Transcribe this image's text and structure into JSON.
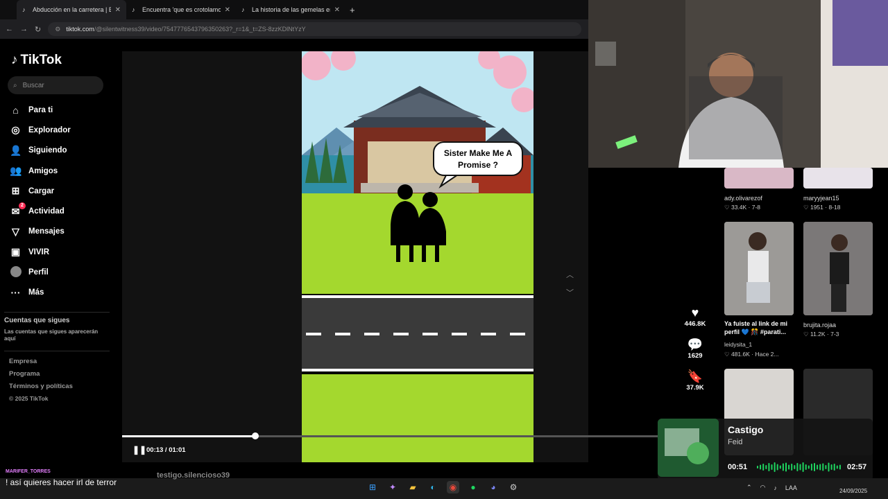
{
  "browser": {
    "tabs": [
      {
        "title": "Abducción en la carretera | Ep",
        "active": true
      },
      {
        "title": "Encuentra 'que es crotolamo' e",
        "active": false
      },
      {
        "title": "La historia de las gemelas en Je",
        "active": false
      }
    ],
    "new_tab": "+",
    "url_domain": "tiktok.com",
    "url_path": "/@silentwitness39/video/7547776543796350263?_r=1&_t=ZS-8zzKDlNtYzY"
  },
  "sidebar": {
    "logo": "TikTok",
    "search_placeholder": "Buscar",
    "nav": [
      {
        "label": "Para ti",
        "icon": "home-icon",
        "glyph": "⌂"
      },
      {
        "label": "Explorador",
        "icon": "compass-icon",
        "glyph": "◎"
      },
      {
        "label": "Siguiendo",
        "icon": "following-icon",
        "glyph": "👤"
      },
      {
        "label": "Amigos",
        "icon": "friends-icon",
        "glyph": "👥"
      },
      {
        "label": "Cargar",
        "icon": "upload-icon",
        "glyph": "⊞"
      },
      {
        "label": "Actividad",
        "icon": "activity-icon",
        "glyph": "✉",
        "badge": "2"
      },
      {
        "label": "Mensajes",
        "icon": "messages-icon",
        "glyph": "▽"
      },
      {
        "label": "VIVIR",
        "icon": "live-icon",
        "glyph": "▣"
      },
      {
        "label": "Perfil",
        "icon": "profile-avatar",
        "glyph": ""
      },
      {
        "label": "Más",
        "icon": "more-icon",
        "glyph": "···"
      }
    ],
    "following_heading": "Cuentas que sigues",
    "following_text": "Las cuentas que sigues aparecerán aquí",
    "footer": [
      "Empresa",
      "Programa",
      "Términos y políticas"
    ],
    "copyright": "© 2025 TikTok"
  },
  "video": {
    "speech": "Sister Make Me A Promise ?",
    "likes": "446.8K",
    "comments": "1629",
    "saves": "37.9K",
    "current_time": "00:13",
    "duration": "01:01",
    "time_display": "00:13 / 01:01",
    "progress": 0.246
  },
  "recommendations": [
    {
      "user": "ady.olivarezof",
      "meta": "♡ 33.4K · 7-8"
    },
    {
      "user": "maryyjean15",
      "meta": "♡ 1951 · 8-18"
    },
    {
      "title": "Ya fuiste al link de mi perfil 💙 🎊 #parati...",
      "user": "leidysita_1",
      "meta": "♡ 481.6K · Hace 2..."
    },
    {
      "user": "brujita.rojaa",
      "meta": "♡ 11.2K · 7-3"
    }
  ],
  "music": {
    "song": "Castigo",
    "artist": "Feid",
    "current": "00:51",
    "duration": "02:57",
    "progress": 0.29,
    "accent": "#1ed760"
  },
  "chat": {
    "username": "MARIFER_TORRES",
    "message": "! así quieres hacer irl de terror",
    "overlay_user": "testigo.silencioso39"
  },
  "taskbar": {
    "icons": [
      "windows-icon",
      "copilot-icon",
      "explorer-icon",
      "edge-icon",
      "chrome-icon",
      "spotify-icon",
      "discord-icon",
      "steam-icon"
    ],
    "lang": "LAA",
    "date": "24/09/2025"
  }
}
